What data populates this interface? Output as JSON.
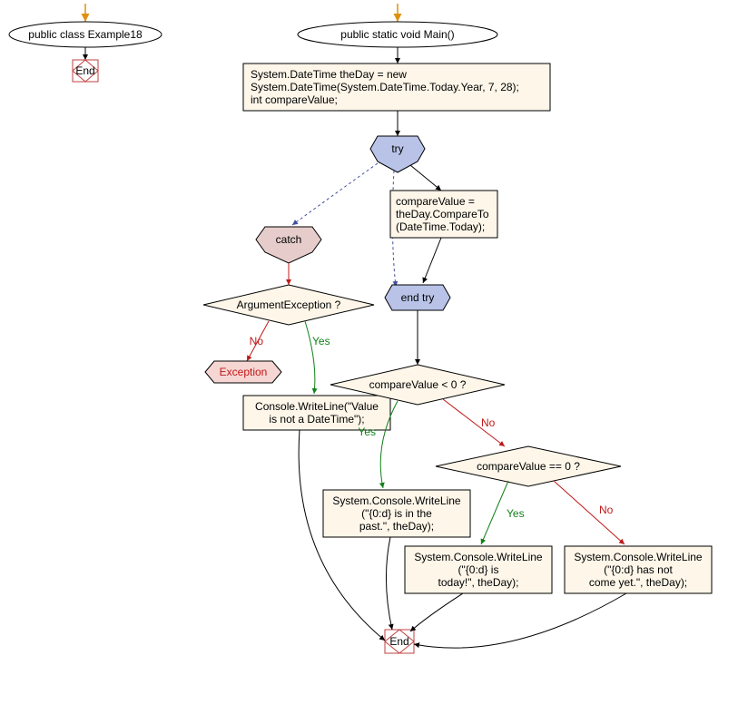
{
  "left": {
    "class_label": "public class Example18",
    "end": "End"
  },
  "main": {
    "method_label": "public static void Main()",
    "init_l1": "System.DateTime theDay = new",
    "init_l2": "System.DateTime(System.DateTime.Today.Year, 7, 28);",
    "init_l3": "int compareValue;",
    "try": "try",
    "catch": "catch",
    "try_body_l1": "compareValue =",
    "try_body_l2": "theDay.CompareTo",
    "try_body_l3": "(DateTime.Today);",
    "end_try": "end try",
    "argexc": "ArgumentException ?",
    "exception": "Exception",
    "catch_body_l1": "Console.WriteLine(\"Value",
    "catch_body_l2": "is not a DateTime\");",
    "cmp_lt0": "compareValue < 0 ?",
    "cmp_eq0": "compareValue == 0 ?",
    "past_l1": "System.Console.WriteLine",
    "past_l2": "(\"{0:d} is in the",
    "past_l3": "past.\", theDay);",
    "today_l1": "System.Console.WriteLine",
    "today_l2": "(\"{0:d} is",
    "today_l3": "today!\", theDay);",
    "notyet_l1": "System.Console.WriteLine",
    "notyet_l2": "(\"{0:d} has not",
    "notyet_l3": "come yet.\", theDay);",
    "end": "End"
  },
  "labels": {
    "yes": "Yes",
    "no": "No"
  }
}
